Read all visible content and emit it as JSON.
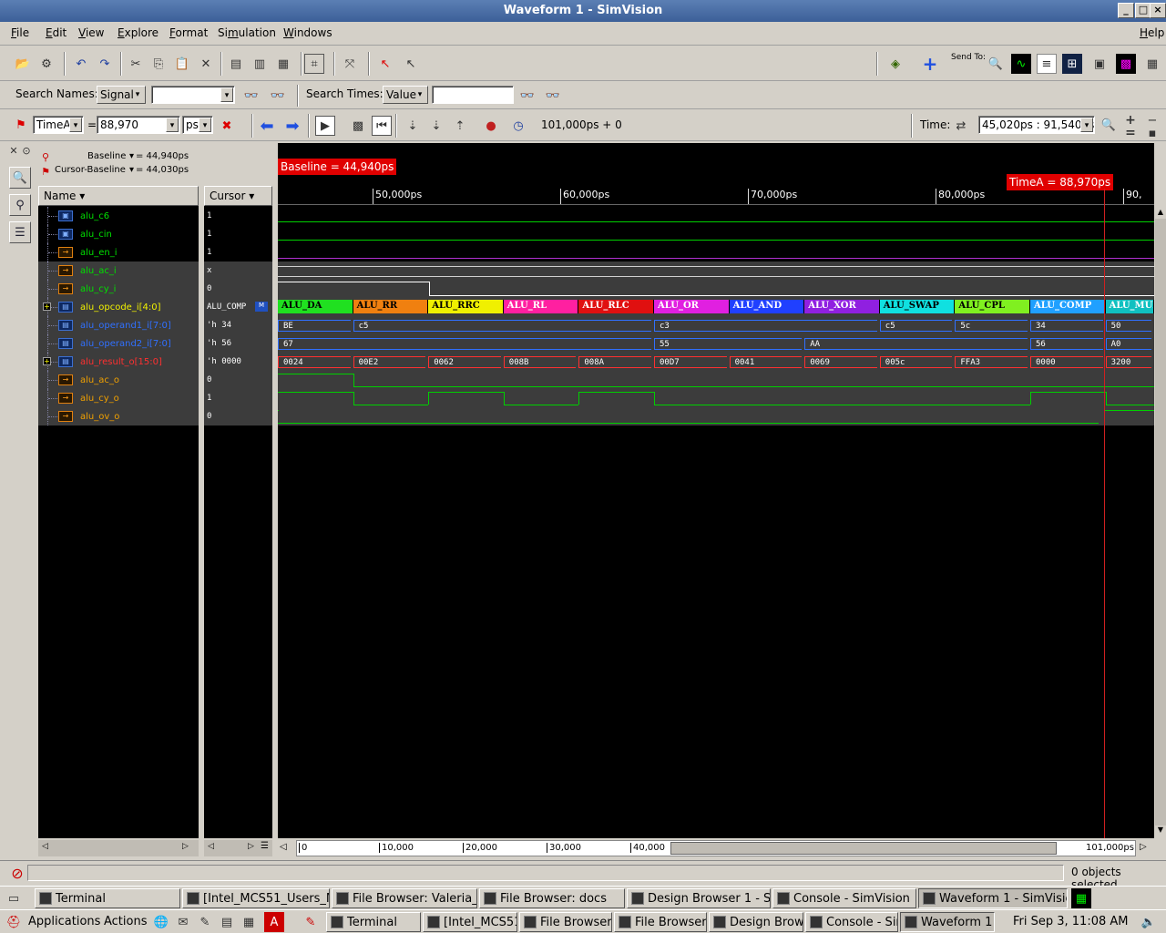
{
  "window": {
    "title": "Waveform 1 - SimVision"
  },
  "menu": [
    {
      "label": "File"
    },
    {
      "label": "Edit"
    },
    {
      "label": "View"
    },
    {
      "label": "Explore"
    },
    {
      "label": "Format"
    },
    {
      "label": "Simulation"
    },
    {
      "label": "Windows"
    }
  ],
  "menu_help": "Help",
  "toolbar": {
    "send_to": "Send To:"
  },
  "search": {
    "names_label": "Search Names:",
    "names_type": "Signal",
    "names_value": "",
    "times_label": "Search Times:",
    "times_type": "Value",
    "times_value": ""
  },
  "cursorbar": {
    "cursor_name": "TimeA",
    "equals": "=",
    "cursor_value": "88,970",
    "unit": "ps",
    "sim_time": "101,000ps + 0",
    "time_label": "Time:",
    "time_range": "45,020ps : 91,540ps"
  },
  "baseline": {
    "baseline_label": "Baseline",
    "baseline_value": "= 44,940ps",
    "cursor_baseline_label": "Cursor-Baseline",
    "cursor_baseline_value": "= 44,030ps"
  },
  "columns": {
    "name": "Name",
    "cursor": "Cursor"
  },
  "signals": [
    {
      "name": "alu_c6",
      "cursor": "1",
      "color": "#00e000"
    },
    {
      "name": "alu_cin",
      "cursor": "1",
      "color": "#00e000"
    },
    {
      "name": "alu_en_i",
      "cursor": "1",
      "color": "#00e000"
    },
    {
      "name": "alu_ac_i",
      "cursor": "x",
      "color": "#00e000"
    },
    {
      "name": "alu_cy_i",
      "cursor": "0",
      "color": "#00e000"
    },
    {
      "name": "alu_opcode_i[4:0]",
      "cursor": "ALU_COMP",
      "color": "#f0f000"
    },
    {
      "name": "alu_operand1_i[7:0]",
      "cursor": "'h 34",
      "color": "#3070ff"
    },
    {
      "name": "alu_operand2_i[7:0]",
      "cursor": "'h 56",
      "color": "#3070ff"
    },
    {
      "name": "alu_result_o[15:0]",
      "cursor": "'h 0000",
      "color": "#ff3030"
    },
    {
      "name": "alu_ac_o",
      "cursor": "0",
      "color": "#f0a000"
    },
    {
      "name": "alu_cy_o",
      "cursor": "1",
      "color": "#f0a000"
    },
    {
      "name": "alu_ov_o",
      "cursor": "0",
      "color": "#f0a000"
    }
  ],
  "wave": {
    "baseline_tag": "Baseline = 44,940ps",
    "cursor_tag": "TimeA = 88,970ps",
    "ticks": [
      "50,000ps",
      "60,000ps",
      "70,000ps",
      "80,000ps",
      "90,"
    ],
    "opcodes": [
      {
        "label": "ALU_DA",
        "color": "#20e020"
      },
      {
        "label": "ALU_RR",
        "color": "#f08010"
      },
      {
        "label": "ALU_RRC",
        "color": "#f0f000"
      },
      {
        "label": "ALU_RL",
        "color": "#ff20a0"
      },
      {
        "label": "ALU_RLC",
        "color": "#e01010"
      },
      {
        "label": "ALU_OR",
        "color": "#e020e0"
      },
      {
        "label": "ALU_AND",
        "color": "#2040ff"
      },
      {
        "label": "ALU_XOR",
        "color": "#9020e0"
      },
      {
        "label": "ALU_SWAP",
        "color": "#10e0e0"
      },
      {
        "label": "ALU_CPL",
        "color": "#80f020"
      },
      {
        "label": "ALU_COMP",
        "color": "#20a0ff"
      },
      {
        "label": "ALU_MUL",
        "color": "#10c0c0"
      }
    ],
    "operand1": [
      "BE",
      "c5",
      "c3",
      "c5",
      "5c",
      "34",
      "50"
    ],
    "operand2": [
      "67",
      "55",
      "AA",
      "56",
      "A0"
    ],
    "result": [
      "0024",
      "00E2",
      "0062",
      "008B",
      "008A",
      "00D7",
      "0041",
      "0069",
      "005c",
      "FFA3",
      "0000",
      "3200"
    ],
    "cy_o_highs": [
      1,
      0,
      1,
      0,
      1,
      0,
      0,
      0,
      0,
      0,
      1,
      0
    ]
  },
  "overview": {
    "ticks": [
      "0",
      "10,000",
      "20,000",
      "30,000",
      "40,000"
    ],
    "end": "101,000ps"
  },
  "status": {
    "objects": "0 objects selected"
  },
  "tasks_top": [
    {
      "label": "Terminal"
    },
    {
      "label": "[Intel_MCS51_Users_M"
    },
    {
      "label": "File Browser: Valeria_F"
    },
    {
      "label": "File Browser: docs"
    },
    {
      "label": "Design Browser 1 - Sim"
    },
    {
      "label": "Console - SimVision"
    },
    {
      "label": "Waveform 1 - SimVisio"
    }
  ],
  "panel": {
    "applications": "Applications",
    "actions": "Actions",
    "clock": "Fri Sep  3, 11:08 AM"
  },
  "tasks_bottom": [
    {
      "label": "Terminal"
    },
    {
      "label": "[Intel_MCS51"
    },
    {
      "label": "File Browser:"
    },
    {
      "label": "File Browser:"
    },
    {
      "label": "Design Brows"
    },
    {
      "label": "Console - Sin"
    },
    {
      "label": "Waveform 1 -"
    }
  ]
}
